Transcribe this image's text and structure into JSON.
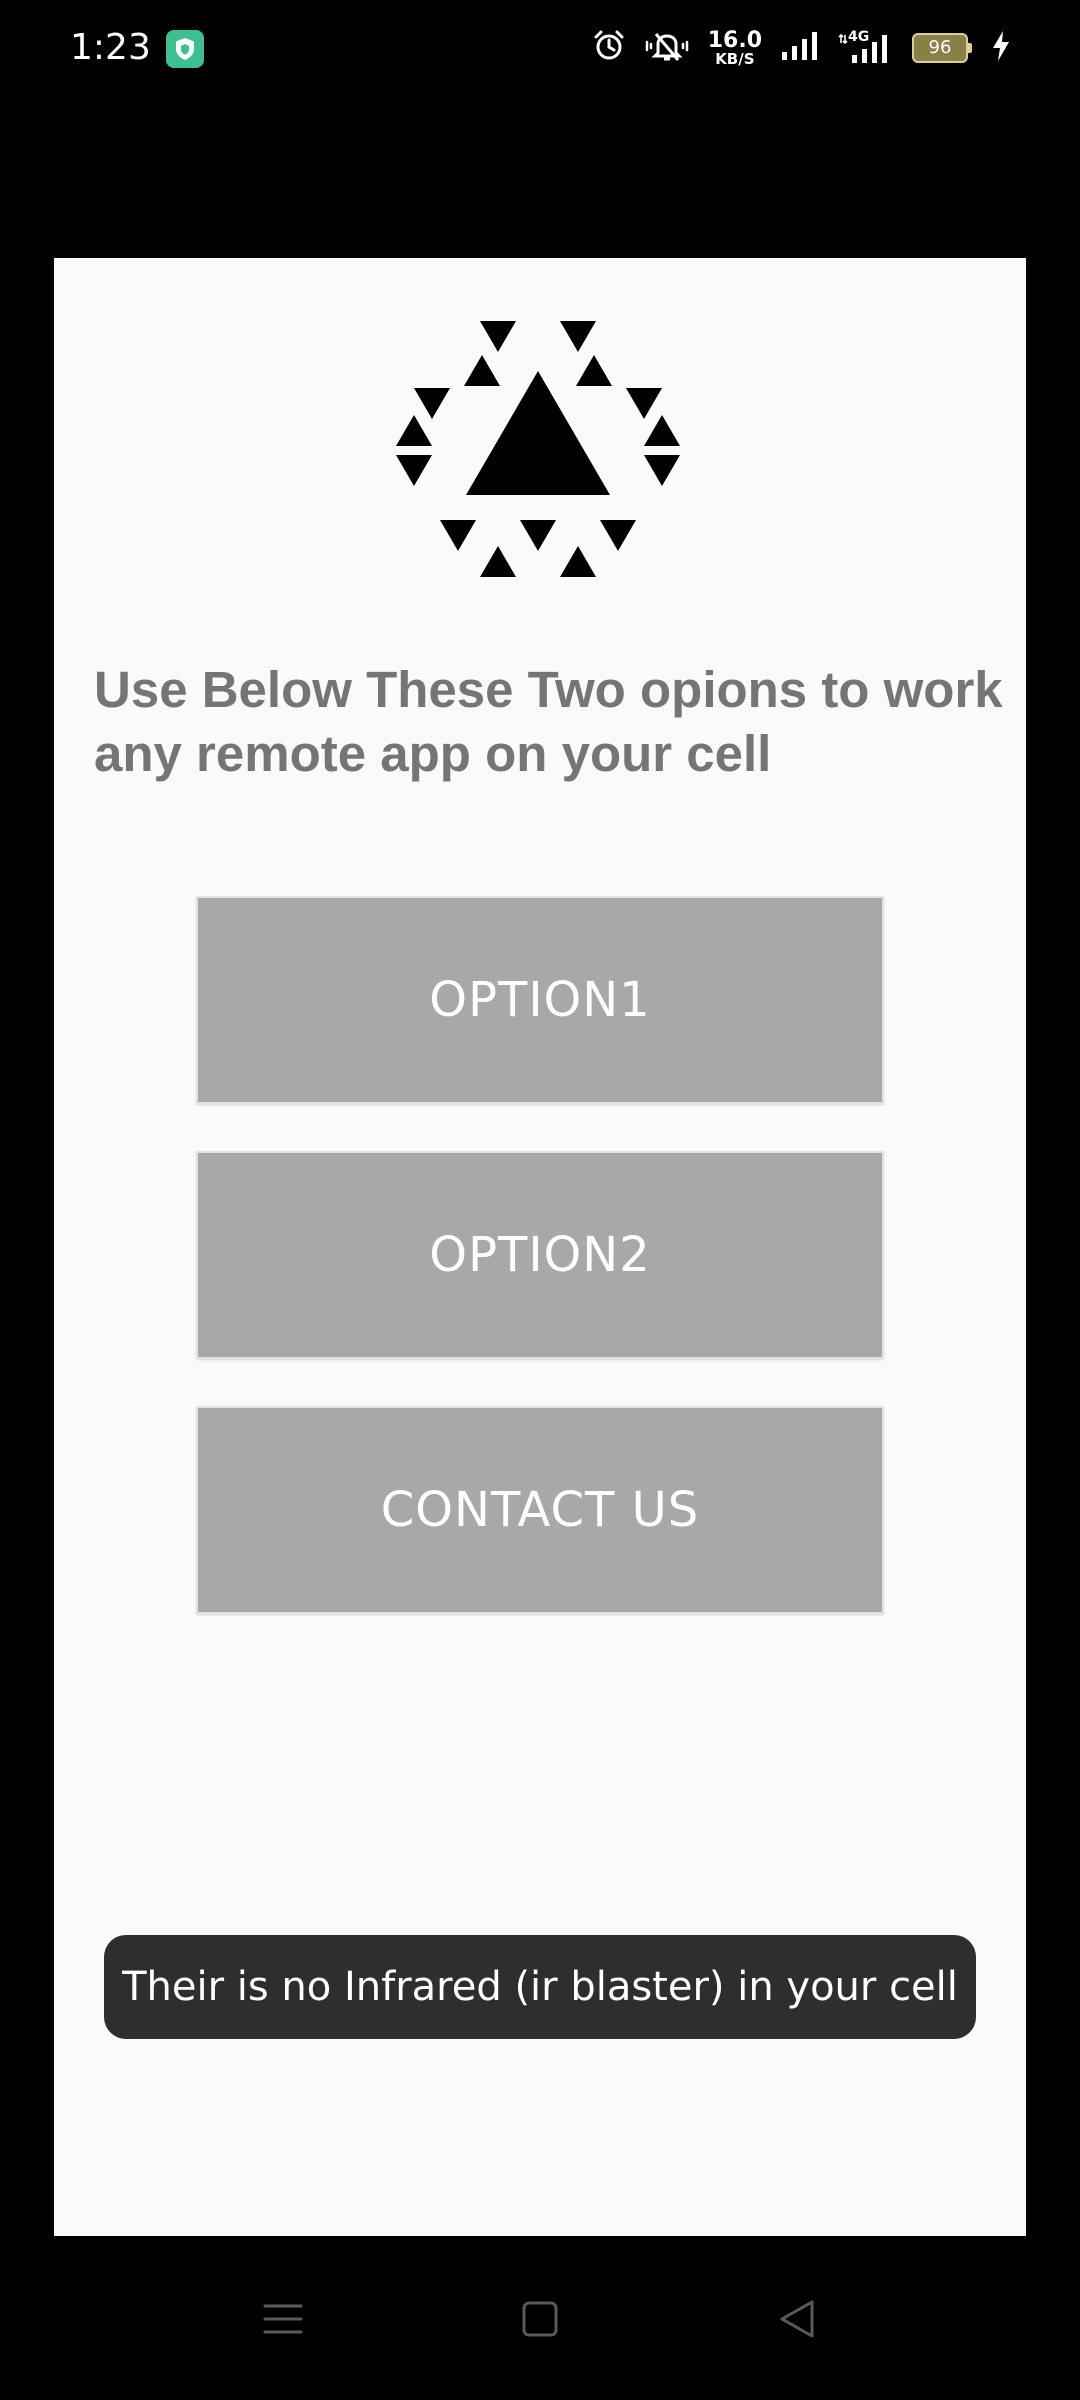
{
  "status_bar": {
    "time": "1:23",
    "speed_value": "16.0",
    "speed_unit": "KB/S",
    "battery_level": "96",
    "signal_type": "4G"
  },
  "app": {
    "logo_icon": "triangle-hexagon-logo-icon",
    "headline": "Use Below These Two opions to work any remote app on your cell",
    "buttons": {
      "option1": "OPTION1",
      "option2": "OPTION2",
      "contact": "CONTACT US"
    },
    "toast": "Their is no Infrared (ir blaster) in your cell"
  },
  "nav_bar": {
    "icons": [
      "menu-icon",
      "home-icon",
      "back-icon"
    ]
  },
  "colors": {
    "card_background": "#fafafa",
    "headline_text": "#757575",
    "button_background": "#a8a8a8",
    "toast_background": "#2e2e2e",
    "shield_badge": "#3fbf8f"
  }
}
